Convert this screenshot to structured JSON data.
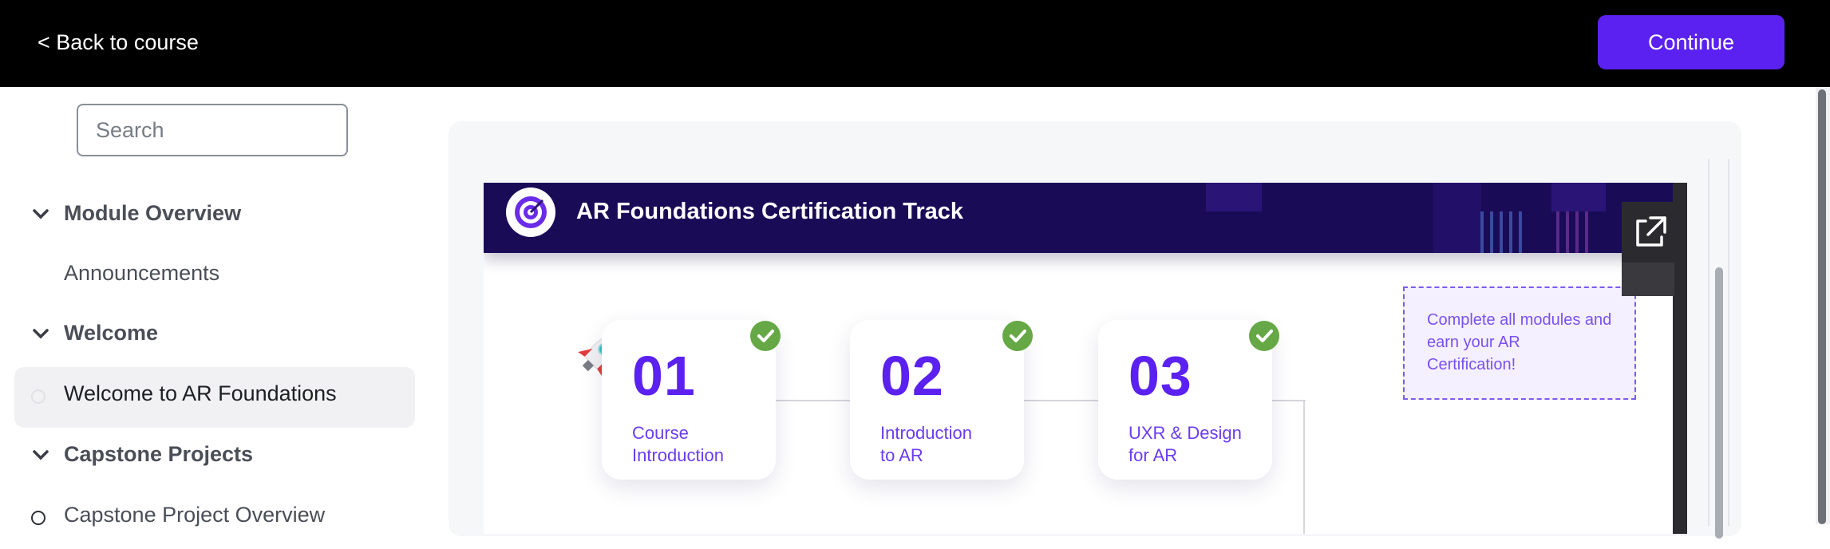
{
  "topbar": {
    "back_label": "< Back to course",
    "continue_label": "Continue",
    "accent_color": "#5b21f0"
  },
  "sidebar": {
    "search_placeholder": "Search",
    "items": [
      {
        "type": "section",
        "label": "Module Overview",
        "icon": "chevron-down-icon"
      },
      {
        "type": "item",
        "label": "Announcements"
      },
      {
        "type": "section",
        "label": "Welcome",
        "icon": "chevron-down-icon"
      },
      {
        "type": "item",
        "label": "Welcome to AR Foundations",
        "selected": true,
        "icon": "circle-icon"
      },
      {
        "type": "section",
        "label": "Capstone Projects",
        "icon": "chevron-down-icon"
      },
      {
        "type": "item",
        "label": "Capstone Project Overview",
        "icon": "circle-icon"
      }
    ]
  },
  "slide": {
    "banner_title": "AR Foundations Certification Track",
    "banner_color": "#1a0b57",
    "steps": [
      {
        "number": "01",
        "label": "Course\nIntroduction",
        "completed": true
      },
      {
        "number": "02",
        "label": "Introduction\nto AR",
        "completed": true
      },
      {
        "number": "03",
        "label": "UXR & Design\nfor AR",
        "completed": true
      }
    ],
    "certification_note": "Complete all modules and earn your AR Certification!",
    "check_color": "#65a845"
  }
}
